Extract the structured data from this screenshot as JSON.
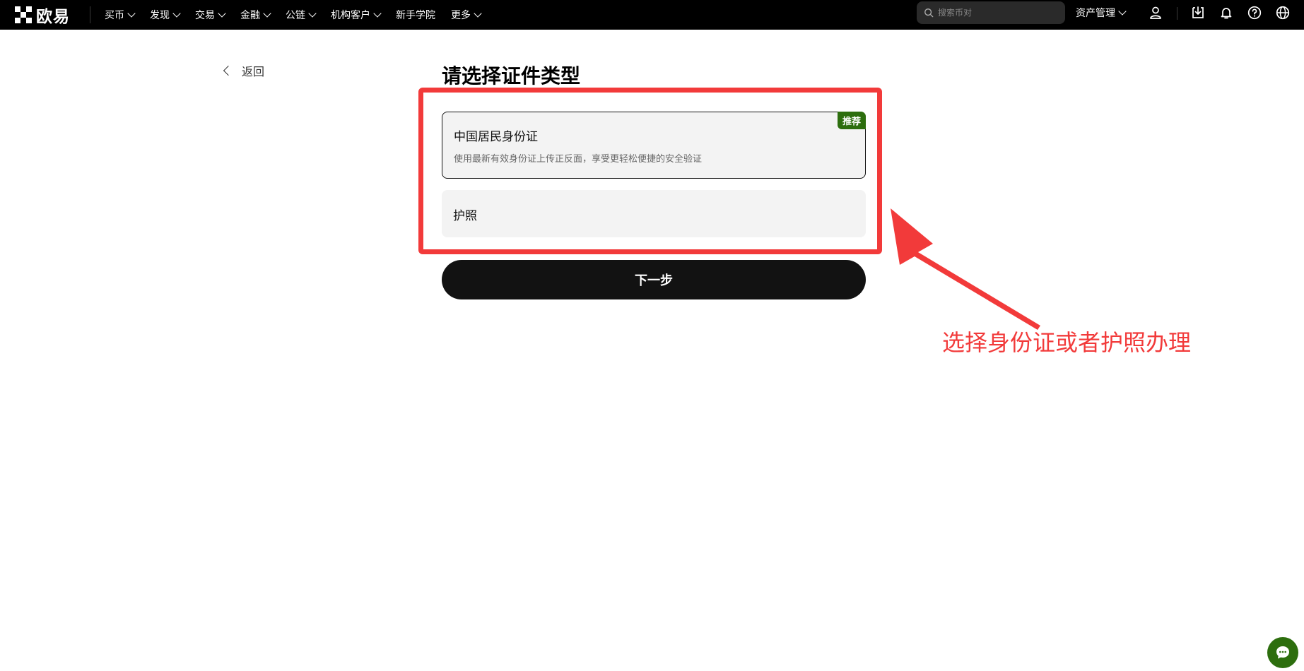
{
  "header": {
    "brand": "欧易",
    "nav": [
      {
        "label": "买币",
        "has_dropdown": true
      },
      {
        "label": "发现",
        "has_dropdown": true
      },
      {
        "label": "交易",
        "has_dropdown": true
      },
      {
        "label": "金融",
        "has_dropdown": true
      },
      {
        "label": "公链",
        "has_dropdown": true
      },
      {
        "label": "机构客户",
        "has_dropdown": true
      },
      {
        "label": "新手学院",
        "has_dropdown": false
      },
      {
        "label": "更多",
        "has_dropdown": true
      }
    ],
    "search_placeholder": "搜索币对",
    "assets_label": "资产管理",
    "icons": [
      "user-icon",
      "download-icon",
      "bell-icon",
      "help-icon",
      "globe-icon"
    ]
  },
  "back_label": "返回",
  "page_title": "请选择证件类型",
  "options": [
    {
      "title": "中国居民身份证",
      "desc": "使用最新有效身份证上传正反面，享受更轻松便捷的安全验证",
      "badge": "推荐",
      "selected": true
    },
    {
      "title": "护照",
      "selected": false
    }
  ],
  "next_label": "下一步",
  "annotation": {
    "text": "选择身份证或者护照办理",
    "color": "#f23a3a"
  },
  "colors": {
    "accent_green": "#2d6e0e",
    "primary_black": "#121212",
    "annotation_red": "#f23a3a"
  }
}
